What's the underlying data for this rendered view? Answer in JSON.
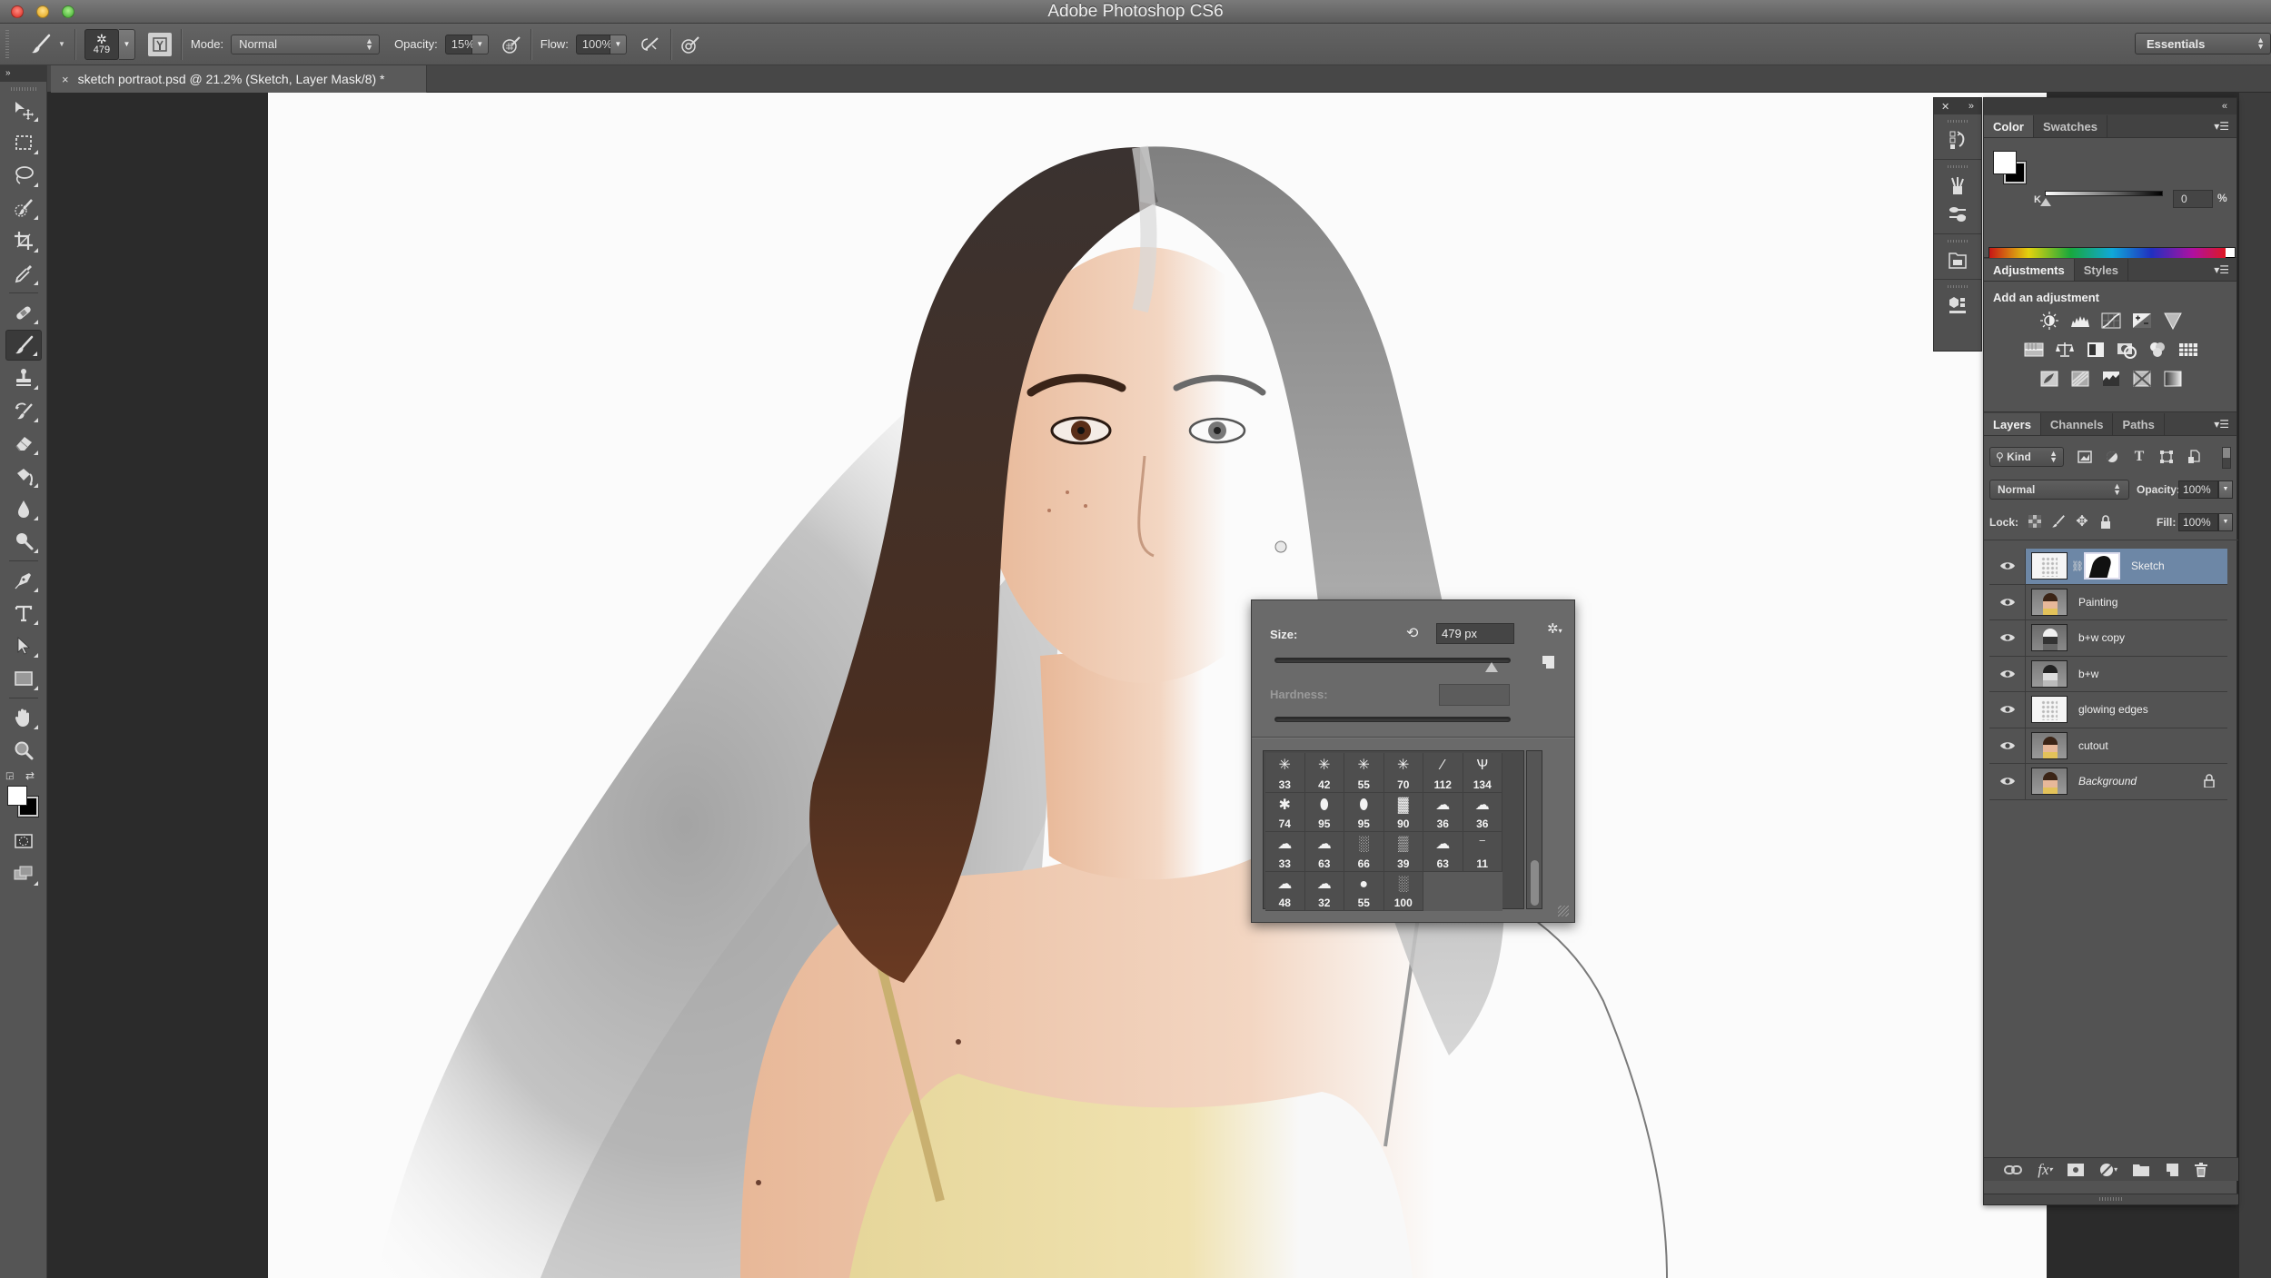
{
  "window": {
    "title": "Adobe Photoshop CS6",
    "traffic_lights": [
      "close",
      "minimize",
      "zoom"
    ]
  },
  "options_bar": {
    "tool_icon": "brush-icon",
    "brush_preset_size": "479",
    "mode_label": "Mode:",
    "mode_value": "Normal",
    "opacity_label": "Opacity:",
    "opacity_value": "15%",
    "flow_label": "Flow:",
    "flow_value": "100%",
    "workspace": "Essentials"
  },
  "document_tab": {
    "close_glyph": "×",
    "title": "sketch portraot.psd @ 21.2% (Sketch, Layer Mask/8) *"
  },
  "toolbar": {
    "collapse_glyph": "»",
    "tools": [
      {
        "name": "move-tool",
        "icon": "move-icon"
      },
      {
        "name": "rectangular-marquee-tool",
        "icon": "marquee-icon"
      },
      {
        "name": "lasso-tool",
        "icon": "lasso-icon"
      },
      {
        "name": "quick-selection-tool",
        "icon": "quick-selection-icon"
      },
      {
        "name": "crop-tool",
        "icon": "crop-icon"
      },
      {
        "name": "eyedropper-tool",
        "icon": "eyedropper-icon"
      },
      {
        "name": "spot-healing-tool",
        "icon": "bandage-icon"
      },
      {
        "name": "brush-tool",
        "icon": "brush-icon",
        "active": true
      },
      {
        "name": "clone-stamp-tool",
        "icon": "stamp-icon"
      },
      {
        "name": "history-brush-tool",
        "icon": "history-brush-icon"
      },
      {
        "name": "eraser-tool",
        "icon": "eraser-icon"
      },
      {
        "name": "paint-bucket-tool",
        "icon": "bucket-icon"
      },
      {
        "name": "blur-tool",
        "icon": "drop-icon"
      },
      {
        "name": "dodge-tool",
        "icon": "dodge-icon"
      },
      {
        "name": "pen-tool",
        "icon": "pen-icon"
      },
      {
        "name": "type-tool",
        "icon": "type-icon"
      },
      {
        "name": "path-selection-tool",
        "icon": "arrow-icon"
      },
      {
        "name": "rectangle-tool",
        "icon": "rectangle-icon"
      },
      {
        "name": "hand-tool",
        "icon": "hand-icon"
      },
      {
        "name": "zoom-tool",
        "icon": "magnifier-icon"
      }
    ],
    "foreground_color": "#ffffff",
    "background_color": "#000000"
  },
  "color_panel": {
    "tabs": [
      "Color",
      "Swatches"
    ],
    "active_tab": "Color",
    "channel_label": "K",
    "channel_value": "0",
    "unit": "%",
    "foreground": "#ffffff",
    "background": "#000000"
  },
  "adjustments_panel": {
    "tabs": [
      "Adjustments",
      "Styles"
    ],
    "active_tab": "Adjustments",
    "title": "Add an adjustment",
    "rows": [
      [
        "brightness-contrast-icon",
        "levels-icon",
        "curves-icon",
        "exposure-icon",
        "vibrance-icon"
      ],
      [
        "hue-saturation-icon",
        "color-balance-icon",
        "black-white-icon",
        "photo-filter-icon",
        "channel-mixer-icon",
        "color-lookup-icon"
      ],
      [
        "invert-icon",
        "posterize-icon",
        "threshold-icon",
        "selective-color-icon",
        "gradient-map-icon"
      ]
    ]
  },
  "layers_panel": {
    "tabs": [
      "Layers",
      "Channels",
      "Paths"
    ],
    "active_tab": "Layers",
    "filter_kind": "Kind",
    "blend_mode": "Normal",
    "opacity_label": "Opacity:",
    "opacity_value": "100%",
    "lock_label": "Lock:",
    "fill_label": "Fill:",
    "fill_value": "100%",
    "layers": [
      {
        "name": "Sketch",
        "visible": true,
        "selected": true,
        "thumb": "white",
        "has_mask": true
      },
      {
        "name": "Painting",
        "visible": true,
        "selected": false,
        "thumb": "photo"
      },
      {
        "name": "b+w copy",
        "visible": true,
        "selected": false,
        "thumb": "bwcopy"
      },
      {
        "name": "b+w",
        "visible": true,
        "selected": false,
        "thumb": "bw"
      },
      {
        "name": "glowing edges",
        "visible": true,
        "selected": false,
        "thumb": "white"
      },
      {
        "name": "cutout",
        "visible": true,
        "selected": false,
        "thumb": "photo"
      },
      {
        "name": "Background",
        "visible": true,
        "selected": false,
        "thumb": "photo",
        "locked": true,
        "italic": true
      }
    ],
    "footer_icons": [
      "link-layers-icon",
      "fx-icon",
      "add-mask-icon",
      "adjustment-layer-icon",
      "group-folder-icon",
      "new-layer-icon",
      "trash-icon"
    ]
  },
  "brush_popup": {
    "size_label": "Size:",
    "size_value": "479 px",
    "size_slider_fraction": 0.92,
    "hardness_label": "Hardness:",
    "hardness_value": "",
    "presets": [
      {
        "size": "33",
        "glyph": "✳"
      },
      {
        "size": "42",
        "glyph": "✳"
      },
      {
        "size": "55",
        "glyph": "✳"
      },
      {
        "size": "70",
        "glyph": "✳"
      },
      {
        "size": "112",
        "glyph": "⁄"
      },
      {
        "size": "134",
        "glyph": "Ѱ"
      },
      {
        "size": "74",
        "glyph": "✱"
      },
      {
        "size": "95",
        "glyph": "⬮"
      },
      {
        "size": "95",
        "glyph": "⬮"
      },
      {
        "size": "90",
        "glyph": "▓"
      },
      {
        "size": "36",
        "glyph": "☁"
      },
      {
        "size": "36",
        "glyph": "☁"
      },
      {
        "size": "33",
        "glyph": "☁"
      },
      {
        "size": "63",
        "glyph": "☁"
      },
      {
        "size": "66",
        "glyph": "░"
      },
      {
        "size": "39",
        "glyph": "▒"
      },
      {
        "size": "63",
        "glyph": "☁"
      },
      {
        "size": "11",
        "glyph": "⁻"
      },
      {
        "size": "48",
        "glyph": "☁"
      },
      {
        "size": "32",
        "glyph": "☁"
      },
      {
        "size": "55",
        "glyph": "●"
      },
      {
        "size": "100",
        "glyph": "░"
      }
    ]
  },
  "mini_strip": {
    "icons": [
      "history-icon",
      "brush-presets-icon",
      "brush-panel-icon",
      "tool-presets-icon",
      "3d-icon"
    ]
  }
}
